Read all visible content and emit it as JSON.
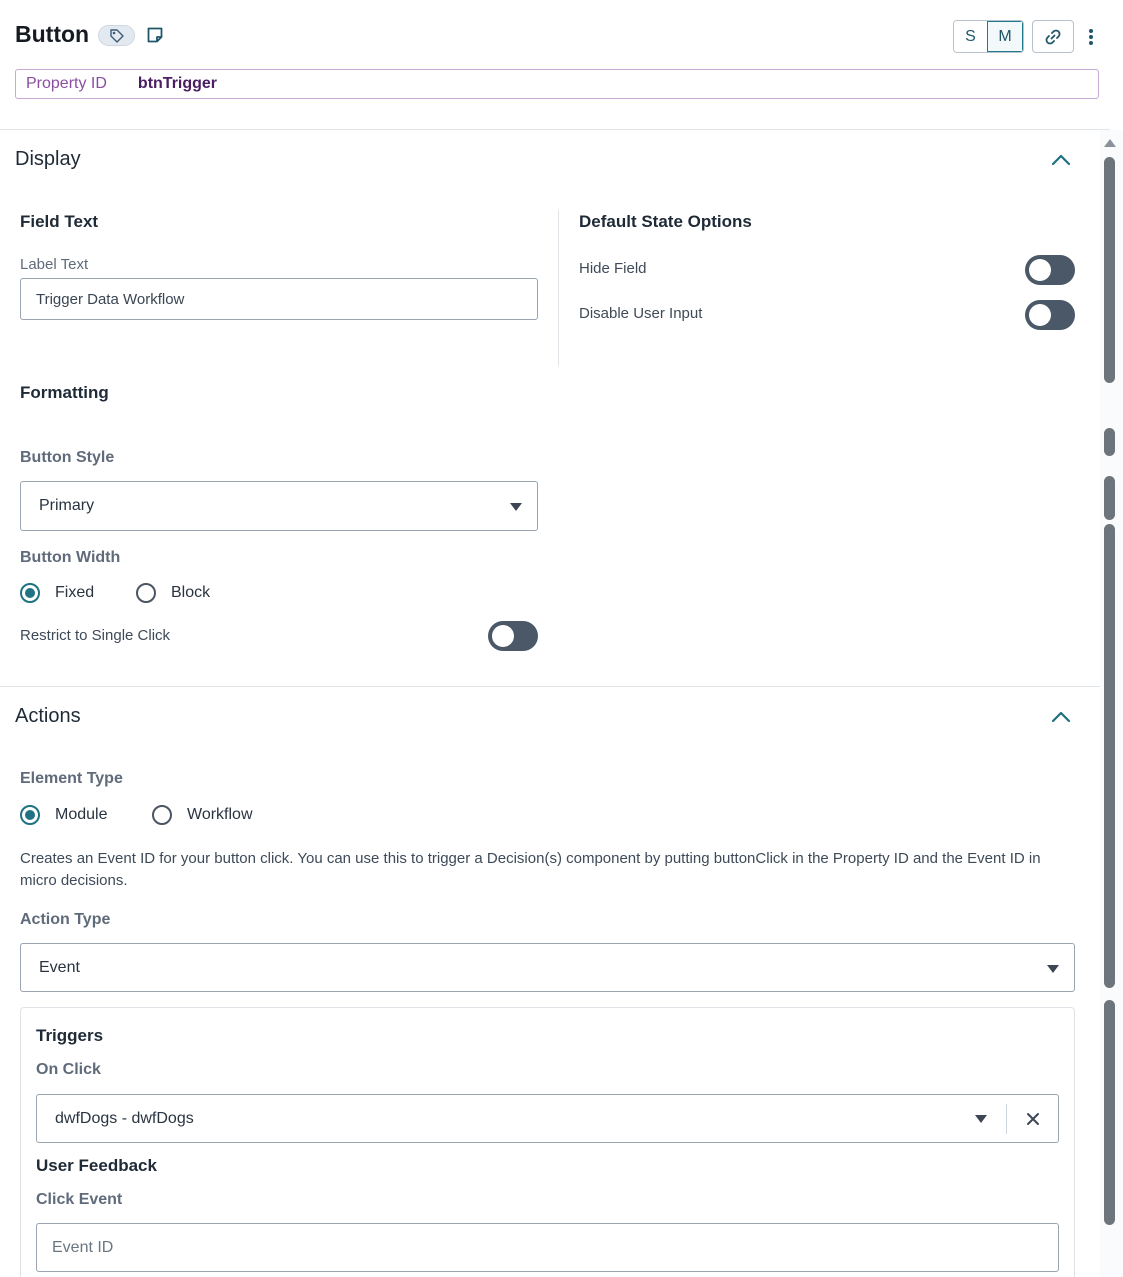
{
  "header": {
    "title": "Button",
    "size_options": [
      "S",
      "M"
    ],
    "selected_size": "M",
    "property_id_label": "Property ID",
    "property_id_value": "btnTrigger"
  },
  "display": {
    "section_title": "Display",
    "field_text_heading": "Field Text",
    "label_text_label": "Label Text",
    "label_text_value": "Trigger Data Workflow",
    "default_state_heading": "Default State Options",
    "hide_field_label": "Hide Field",
    "hide_field_on": false,
    "disable_input_label": "Disable User Input",
    "disable_input_on": false,
    "formatting_heading": "Formatting",
    "button_style_label": "Button Style",
    "button_style_value": "Primary",
    "button_width_label": "Button Width",
    "width_fixed_label": "Fixed",
    "width_block_label": "Block",
    "width_selected": "Fixed",
    "restrict_click_label": "Restrict to Single Click",
    "restrict_click_on": false
  },
  "actions": {
    "section_title": "Actions",
    "element_type_label": "Element Type",
    "module_label": "Module",
    "workflow_label": "Workflow",
    "element_type_selected": "Module",
    "description": "Creates an Event ID for your button click. You can use this to trigger a Decision(s) component by putting buttonClick in the Property ID and the Event ID in micro decisions.",
    "action_type_label": "Action Type",
    "action_type_value": "Event",
    "triggers_heading": "Triggers",
    "on_click_label": "On Click",
    "on_click_value": "dwfDogs - dwfDogs",
    "user_feedback_heading": "User Feedback",
    "click_event_label": "Click Event",
    "click_event_placeholder": "Event ID"
  },
  "colors": {
    "accent": "#1f7383",
    "toggle_off": "#4a5868",
    "property_border": "#c9a8d6"
  },
  "icons": [
    "tag-icon",
    "note-icon",
    "link-icon",
    "kebab-menu-icon",
    "chevron-up-icon",
    "caret-down-icon",
    "close-icon"
  ]
}
